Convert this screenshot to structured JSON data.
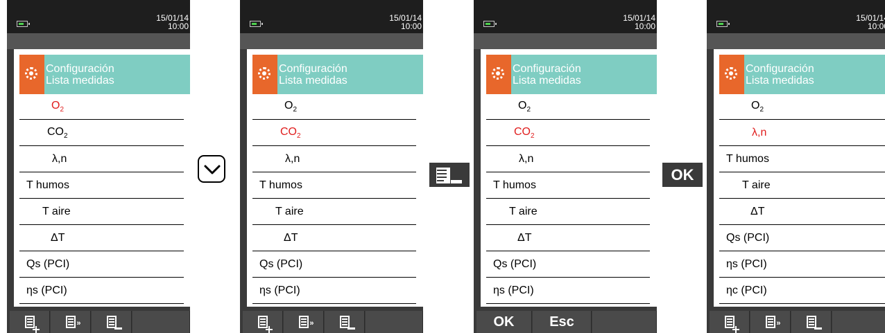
{
  "datetime": {
    "date": "15/01/14",
    "time": "10:00"
  },
  "header": {
    "line1": "Configuración",
    "line2": "Lista medidas"
  },
  "screens": [
    {
      "rows": [
        {
          "label": "O",
          "sub": "2",
          "selected": true,
          "indent": 56
        },
        {
          "label": "CO",
          "sub": "2",
          "selected": false,
          "indent": 50
        },
        {
          "label": "λ,n",
          "sub": "",
          "selected": false,
          "indent": 57
        },
        {
          "label": "T humos",
          "sub": "",
          "selected": false,
          "indent": 20
        },
        {
          "label": "T aire",
          "sub": "",
          "selected": false,
          "indent": 43
        },
        {
          "label": "ΔT",
          "sub": "",
          "selected": false,
          "indent": 55
        },
        {
          "label": "Qs (PCI)",
          "sub": "",
          "selected": false,
          "indent": 20
        },
        {
          "label": "ηs (PCI)",
          "sub": "",
          "selected": false,
          "indent": 20
        }
      ],
      "toolbar": "icons"
    },
    {
      "rows": [
        {
          "label": "O",
          "sub": "2",
          "selected": false,
          "indent": 56
        },
        {
          "label": "CO",
          "sub": "2",
          "selected": true,
          "indent": 50
        },
        {
          "label": "λ,n",
          "sub": "",
          "selected": false,
          "indent": 57
        },
        {
          "label": "T humos",
          "sub": "",
          "selected": false,
          "indent": 20
        },
        {
          "label": "T aire",
          "sub": "",
          "selected": false,
          "indent": 43
        },
        {
          "label": "ΔT",
          "sub": "",
          "selected": false,
          "indent": 55
        },
        {
          "label": "Qs (PCI)",
          "sub": "",
          "selected": false,
          "indent": 20
        },
        {
          "label": "ηs (PCI)",
          "sub": "",
          "selected": false,
          "indent": 20
        }
      ],
      "toolbar": "icons"
    },
    {
      "rows": [
        {
          "label": "O",
          "sub": "2",
          "selected": false,
          "indent": 56
        },
        {
          "label": "CO",
          "sub": "2",
          "selected": true,
          "indent": 50
        },
        {
          "label": "λ,n",
          "sub": "",
          "selected": false,
          "indent": 57
        },
        {
          "label": "T humos",
          "sub": "",
          "selected": false,
          "indent": 20
        },
        {
          "label": "T aire",
          "sub": "",
          "selected": false,
          "indent": 43
        },
        {
          "label": "ΔT",
          "sub": "",
          "selected": false,
          "indent": 55
        },
        {
          "label": "Qs (PCI)",
          "sub": "",
          "selected": false,
          "indent": 20
        },
        {
          "label": "ηs (PCI)",
          "sub": "",
          "selected": false,
          "indent": 20
        }
      ],
      "toolbar": "okesc",
      "ok_label": "OK",
      "esc_label": "Esc"
    },
    {
      "rows": [
        {
          "label": "O",
          "sub": "2",
          "selected": false,
          "indent": 56
        },
        {
          "label": "λ,n",
          "sub": "",
          "selected": true,
          "indent": 57
        },
        {
          "label": "T humos",
          "sub": "",
          "selected": false,
          "indent": 20
        },
        {
          "label": "T aire",
          "sub": "",
          "selected": false,
          "indent": 43
        },
        {
          "label": "ΔT",
          "sub": "",
          "selected": false,
          "indent": 55
        },
        {
          "label": "Qs (PCI)",
          "sub": "",
          "selected": false,
          "indent": 20
        },
        {
          "label": "ηs (PCI)",
          "sub": "",
          "selected": false,
          "indent": 20
        },
        {
          "label": "ηc (PCI)",
          "sub": "",
          "selected": false,
          "indent": 20
        }
      ],
      "toolbar": "icons"
    }
  ],
  "operators": {
    "ok_key_label": "OK"
  },
  "icons": {
    "battery": "battery-icon",
    "settings": "gear-icon",
    "scroll_down": "chevron-down-icon",
    "delete": "list-remove-icon",
    "add": "list-add-icon",
    "move": "list-move-icon"
  },
  "colors": {
    "selected": "#e01d1d",
    "header": "#7fcdc2",
    "header_icon": "#e8672b"
  }
}
